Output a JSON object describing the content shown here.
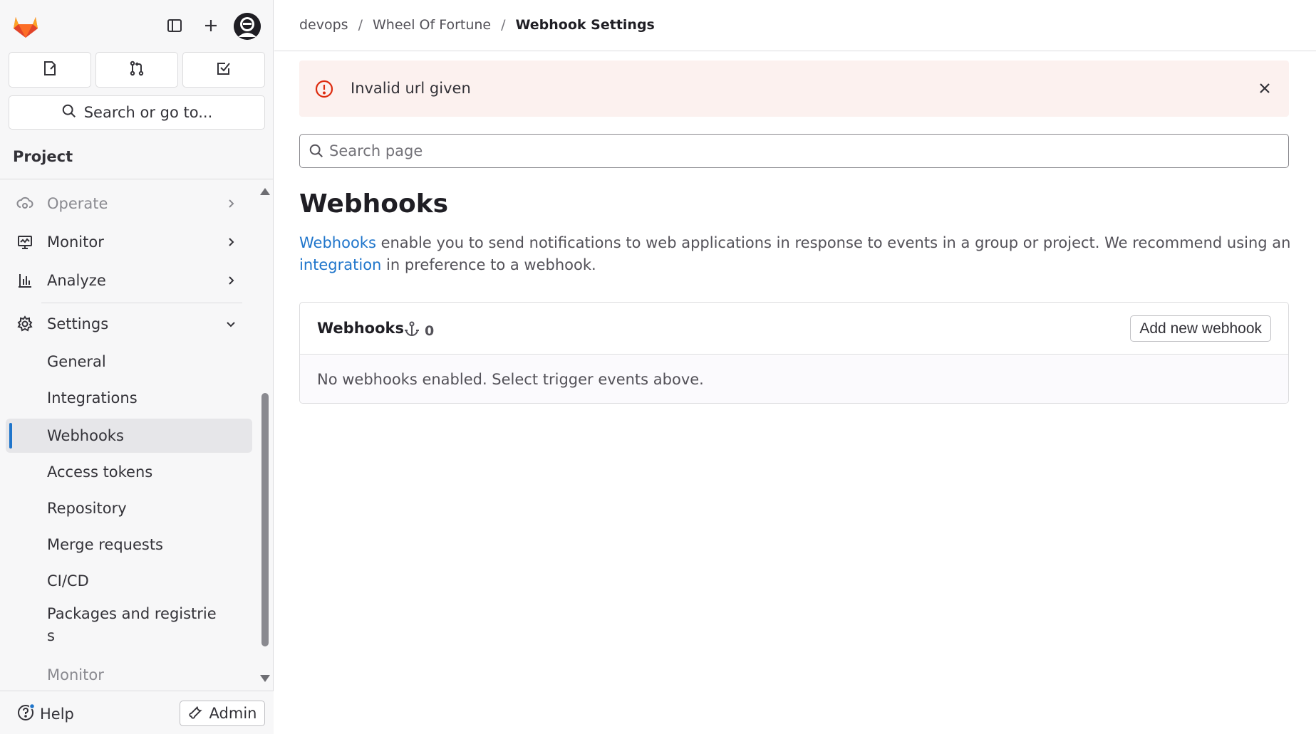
{
  "sidebar": {
    "search_label": "Search or go to...",
    "section_title": "Project",
    "nav": [
      {
        "label": "Operate",
        "icon": "deployments-icon"
      },
      {
        "label": "Monitor",
        "icon": "monitor-icon"
      },
      {
        "label": "Analyze",
        "icon": "chart-icon"
      },
      {
        "label": "Settings",
        "icon": "gear-icon"
      }
    ],
    "settings_items": [
      "General",
      "Integrations",
      "Webhooks",
      "Access tokens",
      "Repository",
      "Merge requests",
      "CI/CD",
      "Packages and registrie s",
      "Monitor"
    ],
    "help_label": "Help",
    "admin_label": "Admin"
  },
  "breadcrumb": {
    "items": [
      "devops",
      "Wheel Of Fortune"
    ],
    "current": "Webhook Settings",
    "separator": "/"
  },
  "alert": {
    "message": "Invalid url given"
  },
  "search": {
    "placeholder": "Search page"
  },
  "page": {
    "title": "Webhooks",
    "desc_link1": "Webhooks",
    "desc_text1": " enable you to send notifications to web applications in response to events in a group or project. We recommend using an ",
    "desc_link2": "integration",
    "desc_text2": " in preference to a webhook."
  },
  "webhooks_card": {
    "title": "Webhooks",
    "count": "0",
    "add_label": "Add new webhook",
    "empty_message": "No webhooks enabled. Select trigger events above."
  },
  "colors": {
    "accent": "#1f75cb",
    "alert_bg": "#fcf1ef",
    "alert_icon": "#dd2b0e"
  }
}
